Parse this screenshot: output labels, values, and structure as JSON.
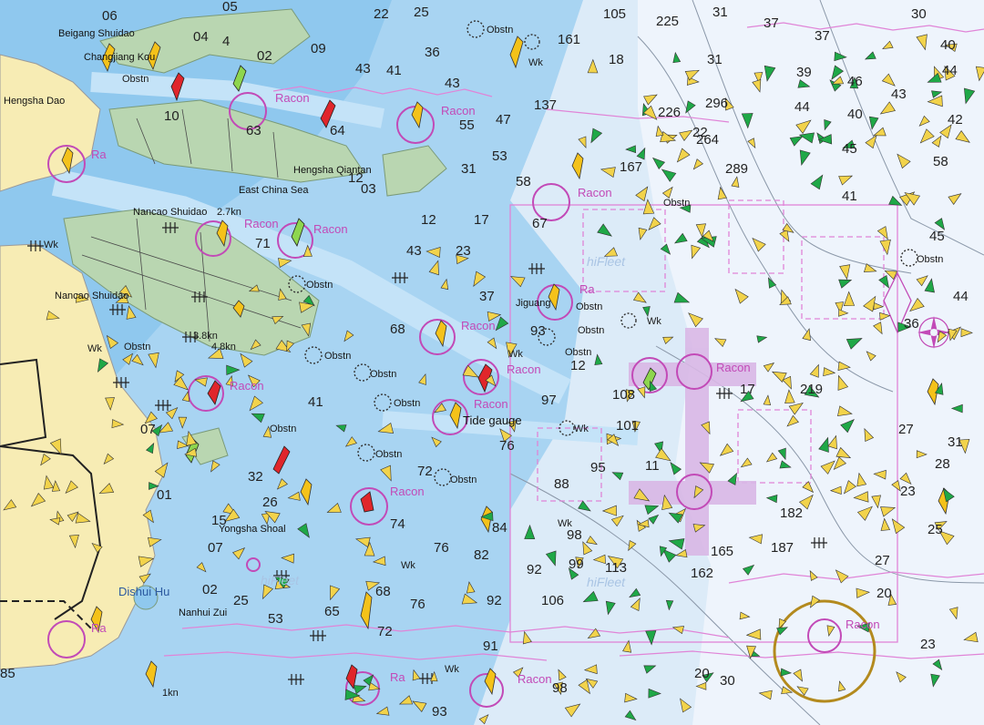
{
  "colors": {
    "land": "#f7ecb4",
    "island": "#b9d6b1",
    "deep_water": "#e8f1fb",
    "mid_water": "#cfe6f7",
    "shallow_water": "#9fd0f2",
    "channel": "#b8dcf5",
    "racon_magenta": "#c24ab7",
    "boundary_pink": "#e084d7",
    "vessel_yellow": "#f2d34b",
    "vessel_green": "#1fa847",
    "buoy_yellow": "#f4c21a",
    "buoy_red": "#e0262b",
    "buoy_green": "#8ed64e"
  },
  "place_labels": [
    {
      "id": "beigang-shuidao",
      "text": "Beigang Shuidao"
    },
    {
      "id": "changjiang-kou",
      "text": "Changjiang Kou"
    },
    {
      "id": "hengsha-dao",
      "text": "Hengsha Dao"
    },
    {
      "id": "hengsha-qiantan",
      "text": "Hengsha Qiantan"
    },
    {
      "id": "east-china-sea",
      "text": "East China Sea"
    },
    {
      "id": "nancao-shuidao",
      "text": "Nancao Shuidao"
    },
    {
      "id": "nancao-shuidao-2",
      "text": "Nancao Shuidao"
    },
    {
      "id": "jiguang",
      "text": "Jiguang"
    },
    {
      "id": "tide-gauge",
      "text": "Tide gauge"
    },
    {
      "id": "dishui-hu",
      "text": "Dishui Hu"
    },
    {
      "id": "nanhui-zui",
      "text": "Nanhui Zui"
    },
    {
      "id": "yongsha-shoal",
      "text": "Yongsha Shoal"
    }
  ],
  "racon_labels": [
    {
      "id": "racon-1",
      "text": "Racon"
    },
    {
      "id": "racon-2",
      "text": "Racon"
    },
    {
      "id": "racon-3",
      "text": "Racon"
    },
    {
      "id": "racon-4",
      "text": "Racon"
    },
    {
      "id": "racon-5",
      "text": "Racon"
    },
    {
      "id": "racon-6",
      "text": "Racon"
    },
    {
      "id": "racon-7",
      "text": "Racon"
    },
    {
      "id": "racon-8",
      "text": "Racon"
    },
    {
      "id": "racon-9",
      "text": "Racon"
    },
    {
      "id": "racon-10",
      "text": "Racon"
    },
    {
      "id": "racon-11",
      "text": "Racon"
    },
    {
      "id": "racon-12",
      "text": "Racon"
    },
    {
      "id": "racon-13",
      "text": "Racon"
    },
    {
      "id": "ra-1",
      "text": "Ra"
    },
    {
      "id": "ra-2",
      "text": "Ra"
    },
    {
      "id": "ra-3",
      "text": "Ra"
    },
    {
      "id": "ra-4",
      "text": "Ra"
    }
  ],
  "obstn_labels": [
    {
      "id": "obstn-1",
      "text": "Obstn"
    },
    {
      "id": "obstn-2",
      "text": "Obstn"
    },
    {
      "id": "obstn-3",
      "text": "Obstn"
    },
    {
      "id": "obstn-4",
      "text": "Obstn"
    },
    {
      "id": "obstn-5",
      "text": "Obstn"
    },
    {
      "id": "obstn-6",
      "text": "Obstn"
    },
    {
      "id": "obstn-7",
      "text": "Obstn"
    },
    {
      "id": "obstn-8",
      "text": "Obstn"
    },
    {
      "id": "obstn-9",
      "text": "Obstn"
    },
    {
      "id": "obstn-10",
      "text": "Obstn"
    },
    {
      "id": "obstn-11",
      "text": "Obstn"
    },
    {
      "id": "obstn-12",
      "text": "Obstn"
    },
    {
      "id": "obstn-13",
      "text": "Obstn"
    },
    {
      "id": "obstn-14",
      "text": "Obstn"
    },
    {
      "id": "obstn-15",
      "text": "Obstn"
    }
  ],
  "wk_labels": [
    {
      "id": "wk-1",
      "text": "Wk"
    },
    {
      "id": "wk-2",
      "text": "Wk"
    },
    {
      "id": "wk-3",
      "text": "Wk"
    },
    {
      "id": "wk-4",
      "text": "Wk"
    },
    {
      "id": "wk-5",
      "text": "Wk"
    },
    {
      "id": "wk-6",
      "text": "Wk"
    },
    {
      "id": "wk-7",
      "text": "Wk"
    },
    {
      "id": "wk-8",
      "text": "Wk"
    },
    {
      "id": "wk-9",
      "text": "Wk"
    }
  ],
  "kn_labels": [
    {
      "id": "kn-1",
      "text": "2.7kn"
    },
    {
      "id": "kn-2",
      "text": "4.8kn"
    },
    {
      "id": "kn-3",
      "text": "3.8kn"
    },
    {
      "id": "kn-4",
      "text": "1kn"
    }
  ],
  "watermarks": [
    {
      "id": "hifleet-1",
      "text": "hiFleet"
    },
    {
      "id": "hifleet-2",
      "text": "hiFleet"
    },
    {
      "id": "hifleet-3",
      "text": "hiFleet"
    }
  ],
  "soundings": [
    {
      "id": "s1",
      "text": "06"
    },
    {
      "id": "s2",
      "text": "04"
    },
    {
      "id": "s3",
      "text": "4"
    },
    {
      "id": "s4",
      "text": "02"
    },
    {
      "id": "s5",
      "text": "09"
    },
    {
      "id": "s6",
      "text": "43"
    },
    {
      "id": "s7",
      "text": "41"
    },
    {
      "id": "s8",
      "text": "22"
    },
    {
      "id": "s9",
      "text": "25"
    },
    {
      "id": "s10",
      "text": "36"
    },
    {
      "id": "s11",
      "text": "43"
    },
    {
      "id": "s12",
      "text": "55"
    },
    {
      "id": "s13",
      "text": "47"
    },
    {
      "id": "s14",
      "text": "53"
    },
    {
      "id": "s15",
      "text": "31"
    },
    {
      "id": "s16",
      "text": "58"
    },
    {
      "id": "s17",
      "text": "12"
    },
    {
      "id": "s18",
      "text": "17"
    },
    {
      "id": "s19",
      "text": "43"
    },
    {
      "id": "s20",
      "text": "23"
    },
    {
      "id": "s21",
      "text": "37"
    },
    {
      "id": "s22",
      "text": "97"
    },
    {
      "id": "s23",
      "text": "41"
    },
    {
      "id": "s24",
      "text": "76"
    },
    {
      "id": "s25",
      "text": "82"
    },
    {
      "id": "s26",
      "text": "92"
    },
    {
      "id": "s27",
      "text": "99"
    },
    {
      "id": "s28",
      "text": "98"
    },
    {
      "id": "s29",
      "text": "76"
    },
    {
      "id": "s30",
      "text": "92"
    },
    {
      "id": "s31",
      "text": "68"
    },
    {
      "id": "s32",
      "text": "72"
    },
    {
      "id": "s33",
      "text": "65"
    },
    {
      "id": "s34",
      "text": "15"
    },
    {
      "id": "s35",
      "text": "07"
    },
    {
      "id": "s36",
      "text": "02"
    },
    {
      "id": "s37",
      "text": "25"
    },
    {
      "id": "s38",
      "text": "53"
    },
    {
      "id": "s39",
      "text": "05"
    },
    {
      "id": "s40",
      "text": "105"
    },
    {
      "id": "s41",
      "text": "161"
    },
    {
      "id": "s42",
      "text": "18"
    },
    {
      "id": "s43",
      "text": "137"
    },
    {
      "id": "s44",
      "text": "225"
    },
    {
      "id": "s45",
      "text": "31"
    },
    {
      "id": "s46",
      "text": "37"
    },
    {
      "id": "s47",
      "text": "37"
    },
    {
      "id": "s48",
      "text": "40"
    },
    {
      "id": "s49",
      "text": "30"
    },
    {
      "id": "s50",
      "text": "31"
    },
    {
      "id": "s51",
      "text": "39"
    },
    {
      "id": "s52",
      "text": "44"
    },
    {
      "id": "s53",
      "text": "46"
    },
    {
      "id": "s54",
      "text": "43"
    },
    {
      "id": "s55",
      "text": "44"
    },
    {
      "id": "s56",
      "text": "40"
    },
    {
      "id": "s57",
      "text": "42"
    },
    {
      "id": "s58",
      "text": "45"
    },
    {
      "id": "s59",
      "text": "58"
    },
    {
      "id": "s60",
      "text": "41"
    },
    {
      "id": "s61",
      "text": "45"
    },
    {
      "id": "s62",
      "text": "36"
    },
    {
      "id": "s63",
      "text": "44"
    },
    {
      "id": "s64",
      "text": "27"
    },
    {
      "id": "s65",
      "text": "31"
    },
    {
      "id": "s66",
      "text": "28"
    },
    {
      "id": "s67",
      "text": "23"
    },
    {
      "id": "s68",
      "text": "23"
    },
    {
      "id": "s69",
      "text": "27"
    },
    {
      "id": "s70",
      "text": "20"
    },
    {
      "id": "s71",
      "text": "219"
    },
    {
      "id": "s72",
      "text": "182"
    },
    {
      "id": "s73",
      "text": "187"
    },
    {
      "id": "s74",
      "text": "165"
    },
    {
      "id": "s75",
      "text": "162"
    },
    {
      "id": "s76",
      "text": "113"
    },
    {
      "id": "s77",
      "text": "106"
    },
    {
      "id": "s78",
      "text": "101"
    },
    {
      "id": "s79",
      "text": "108"
    },
    {
      "id": "s80",
      "text": "11"
    },
    {
      "id": "s81",
      "text": "12"
    },
    {
      "id": "s82",
      "text": "22"
    },
    {
      "id": "s83",
      "text": "264"
    },
    {
      "id": "s84",
      "text": "289"
    },
    {
      "id": "s85",
      "text": "296"
    },
    {
      "id": "s86",
      "text": "226"
    },
    {
      "id": "s87",
      "text": "167"
    },
    {
      "id": "s88",
      "text": "25"
    },
    {
      "id": "s89",
      "text": "30"
    },
    {
      "id": "s90",
      "text": "20"
    },
    {
      "id": "s91",
      "text": "85"
    },
    {
      "id": "s92",
      "text": "93"
    },
    {
      "id": "s93",
      "text": "76"
    },
    {
      "id": "s94",
      "text": "98"
    },
    {
      "id": "s95",
      "text": "91"
    },
    {
      "id": "s96",
      "text": "72"
    },
    {
      "id": "s97",
      "text": "88"
    },
    {
      "id": "s98",
      "text": "95"
    },
    {
      "id": "s99",
      "text": "10"
    },
    {
      "id": "s100",
      "text": "63"
    },
    {
      "id": "s101",
      "text": "64"
    },
    {
      "id": "s102",
      "text": "12"
    },
    {
      "id": "s103",
      "text": "71"
    },
    {
      "id": "s104",
      "text": "68"
    },
    {
      "id": "s105",
      "text": "03"
    },
    {
      "id": "s106",
      "text": "32"
    },
    {
      "id": "s107",
      "text": "26"
    },
    {
      "id": "s108",
      "text": "07"
    },
    {
      "id": "s109",
      "text": "01"
    },
    {
      "id": "s110",
      "text": "67"
    },
    {
      "id": "s111",
      "text": "93"
    },
    {
      "id": "s112",
      "text": "74"
    },
    {
      "id": "s113",
      "text": "84"
    },
    {
      "id": "s114",
      "text": "17"
    }
  ]
}
